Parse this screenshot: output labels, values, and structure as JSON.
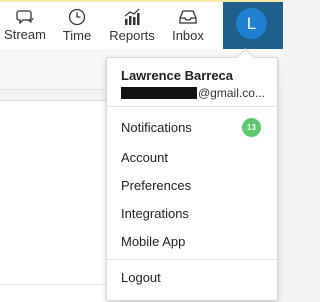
{
  "nav": {
    "items": [
      {
        "label": "Stream",
        "icon": "stream-icon"
      },
      {
        "label": "Time",
        "icon": "clock-icon"
      },
      {
        "label": "Reports",
        "icon": "reports-icon"
      },
      {
        "label": "Inbox",
        "icon": "inbox-icon"
      }
    ],
    "avatar_initial": "L"
  },
  "user_menu": {
    "name": "Lawrence Barreca",
    "email_visible": "@gmail.co...",
    "items": [
      {
        "label": "Notifications",
        "badge": "13"
      },
      {
        "label": "Account"
      },
      {
        "label": "Preferences"
      },
      {
        "label": "Integrations"
      },
      {
        "label": "Mobile App"
      }
    ],
    "logout_label": "Logout"
  },
  "colors": {
    "accent": "#1f5f8b",
    "avatar_bg": "#1f7fd1",
    "badge_green": "#5cc86e",
    "top_border": "#f5e9a6"
  }
}
